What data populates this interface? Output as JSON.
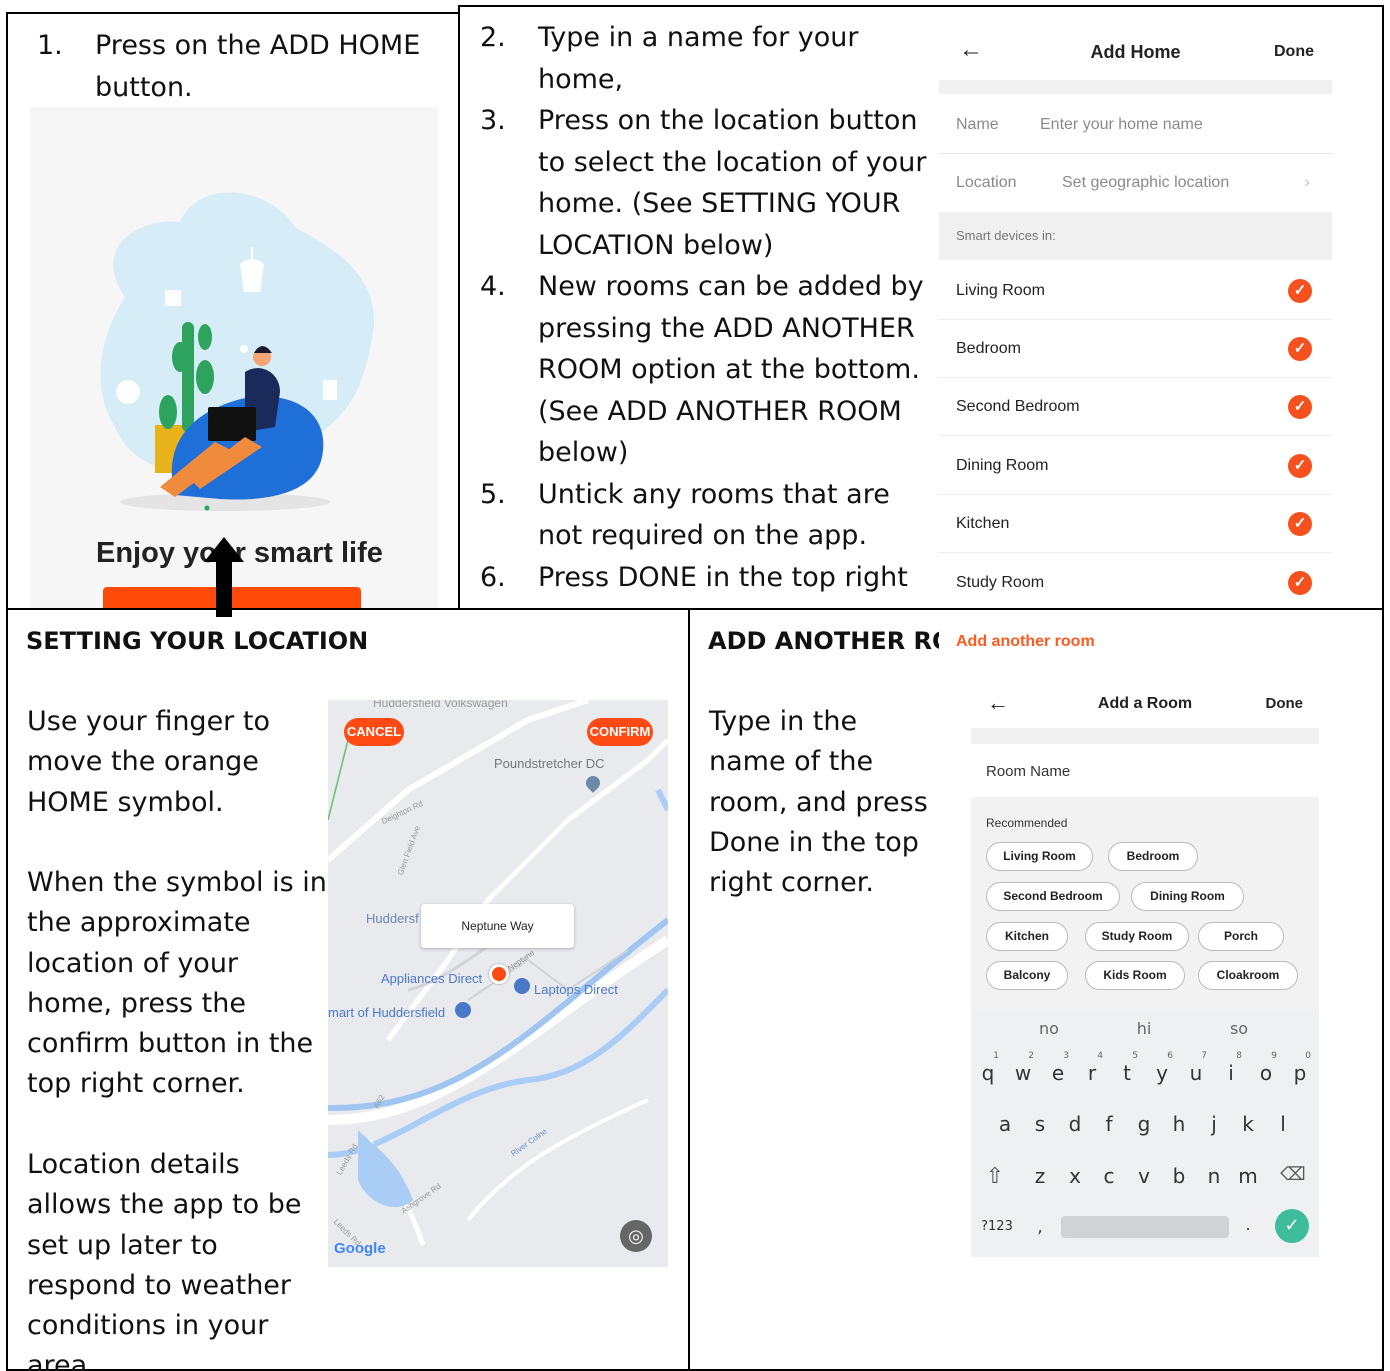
{
  "step1": {
    "number": "1.",
    "text": "Press on the ADD HOME button.",
    "illustration": {
      "tagline": "Enjoy your smart life"
    }
  },
  "steps": [
    {
      "number": "2.",
      "text": "Type in a name for your home,"
    },
    {
      "number": "3.",
      "text": "Press on the location button to select the location of your home.  (See SETTING YOUR LOCATION below)"
    },
    {
      "number": "4.",
      "text": "New rooms can be added by pressing the ADD ANOTHER ROOM option at the bottom. (See ADD ANOTHER ROOM below)"
    },
    {
      "number": "5.",
      "text": "Untick any rooms that are not required on the app."
    },
    {
      "number": "6.",
      "text": "Press DONE in the top right"
    }
  ],
  "add_home_screen": {
    "back_icon": "arrow-left-icon",
    "title": "Add Home",
    "done": "Done",
    "name_label": "Name",
    "name_placeholder": "Enter your home name",
    "location_label": "Location",
    "location_value": "Set geographic location",
    "chevron": "›",
    "section_label": "Smart devices in:",
    "rooms": [
      "Living Room",
      "Bedroom",
      "Second Bedroom",
      "Dining Room",
      "Kitchen",
      "Study Room"
    ],
    "add_another": "Add another room",
    "accent_color": "#f4511e"
  },
  "setting_location": {
    "heading": "SETTING YOUR LOCATION",
    "para1": "Use your finger to move the orange HOME symbol.",
    "para2": "When the symbol is in the approximate location of your home, press the confirm button in the top right corner.",
    "para3": "Location details allows the app to be set up later to respond to weather conditions in your area."
  },
  "map": {
    "top_cut": "Huddersfield Volkswagen",
    "cancel": "CANCEL",
    "confirm": "CONFIRM",
    "poi1": "Poundstretcher DC",
    "place_huddersf": "Huddersf",
    "callout": "Neptune Way",
    "poi2": "Appliances Direct",
    "poi3": "Laptops Direct",
    "poi4": "mart of Huddersfield",
    "streets": [
      "Deighton Rd",
      "Glen Field Ave",
      "A62",
      "Leeds Rd",
      "Ashgrove Rd",
      "River Colne",
      "Neptune",
      "Leeds Rd"
    ],
    "google": "Google"
  },
  "add_room_section": {
    "heading": "ADD ANOTHER RO",
    "text": "Type in the name of the room, and press Done in the top right corner."
  },
  "add_room_screen": {
    "title": "Add a Room",
    "done": "Done",
    "room_name_label": "Room Name",
    "recommended_label": "Recommended",
    "chips": [
      "Living Room",
      "Bedroom",
      "Second Bedroom",
      "Dining Room",
      "Kitchen",
      "Study Room",
      "Porch",
      "Balcony",
      "Kids Room",
      "Cloakroom"
    ]
  },
  "keyboard": {
    "suggestions": [
      "no",
      "hi",
      "so"
    ],
    "row1": [
      "q",
      "w",
      "e",
      "r",
      "t",
      "y",
      "u",
      "i",
      "o",
      "p"
    ],
    "row1_nums": [
      "1",
      "2",
      "3",
      "4",
      "5",
      "6",
      "7",
      "8",
      "9",
      "0"
    ],
    "row2": [
      "a",
      "s",
      "d",
      "f",
      "g",
      "h",
      "j",
      "k",
      "l"
    ],
    "row3": [
      "z",
      "x",
      "c",
      "v",
      "b",
      "n",
      "m"
    ],
    "sym_key": "?123",
    "comma": ",",
    "period": "."
  }
}
